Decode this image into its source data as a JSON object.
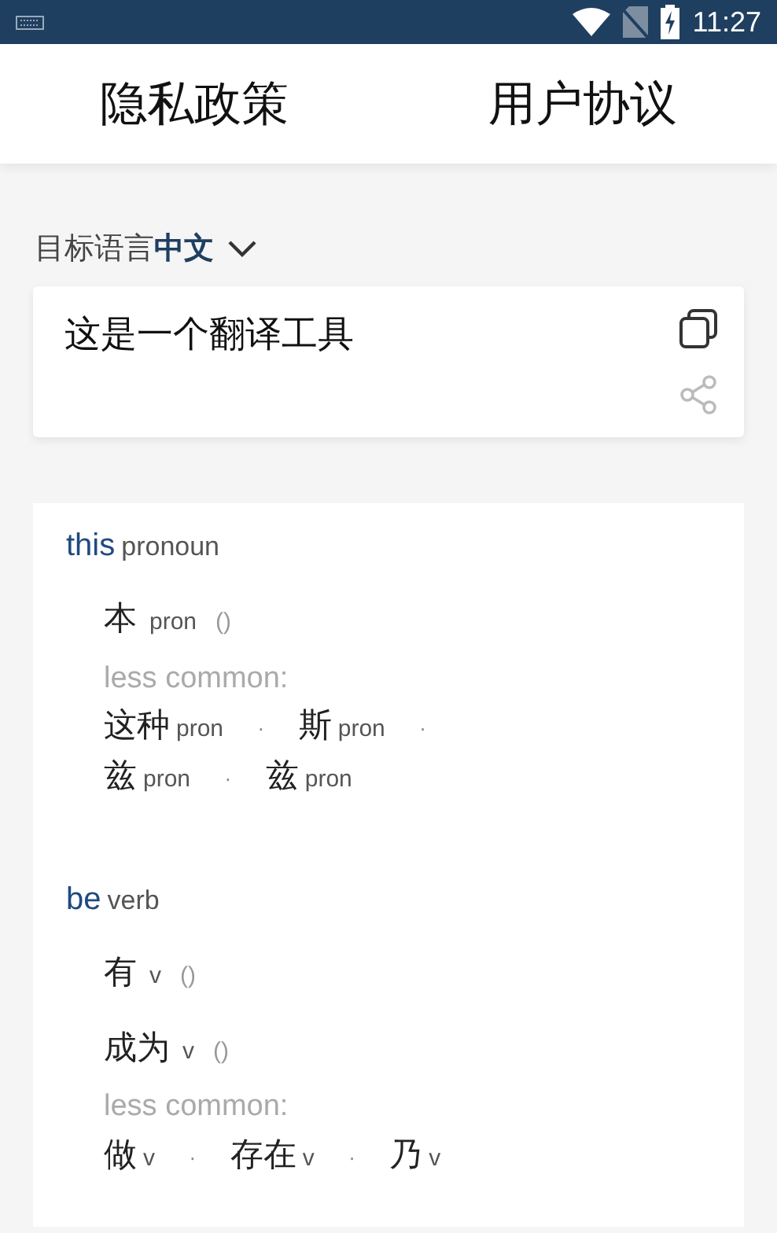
{
  "status_bar": {
    "time": "11:27"
  },
  "tabs": [
    {
      "label": "隐私政策"
    },
    {
      "label": "用户协议"
    }
  ],
  "target_language": {
    "label": "目标语言",
    "value": "中文"
  },
  "translation": {
    "text": "这是一个翻译工具"
  },
  "entries": [
    {
      "word": "this",
      "pos": "pronoun",
      "translations": [
        {
          "word": "本",
          "pos": "pron",
          "note": "()"
        }
      ],
      "less_common_label": "less common:",
      "less_common_rows": [
        [
          {
            "word": "这种",
            "pos": "pron",
            "separator": "·"
          },
          {
            "word": "斯",
            "pos": "pron",
            "separator": "·"
          }
        ],
        [
          {
            "word": "兹",
            "pos": "pron",
            "separator": "·"
          },
          {
            "word": "兹",
            "pos": "pron"
          }
        ]
      ]
    },
    {
      "word": "be",
      "pos": "verb",
      "translations": [
        {
          "word": "有",
          "pos": "v",
          "note": "()"
        },
        {
          "word": "成为",
          "pos": "v",
          "note": "()"
        }
      ],
      "less_common_label": "less common:",
      "less_common_rows": [
        [
          {
            "word": "做",
            "pos": "v",
            "separator": "·"
          },
          {
            "word": "存在",
            "pos": "v",
            "separator": "·"
          },
          {
            "word": "乃",
            "pos": "v"
          }
        ]
      ]
    }
  ]
}
